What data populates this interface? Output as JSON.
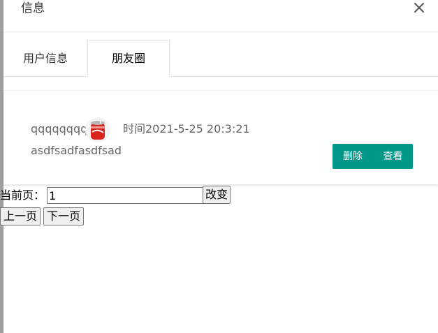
{
  "dialog": {
    "title": "信息",
    "close_icon": "close-icon"
  },
  "tabs": [
    {
      "label": "用户信息",
      "active": false
    },
    {
      "label": "朋友圈",
      "active": true
    }
  ],
  "post": {
    "username": "qqqqqqqq",
    "avatar_icon": "red-can-avatar",
    "time": "时间2021-5-25 20:3:21",
    "content": "asdfsadfasdfsad",
    "delete_label": "删除",
    "view_label": "查看"
  },
  "pager": {
    "label": "当前页：",
    "current_page": "1",
    "change_label": "改变",
    "prev_label": "上一页",
    "next_label": "下一页"
  },
  "colors": {
    "accent": "#009688",
    "overlay_edge": "#9e9e9e"
  }
}
